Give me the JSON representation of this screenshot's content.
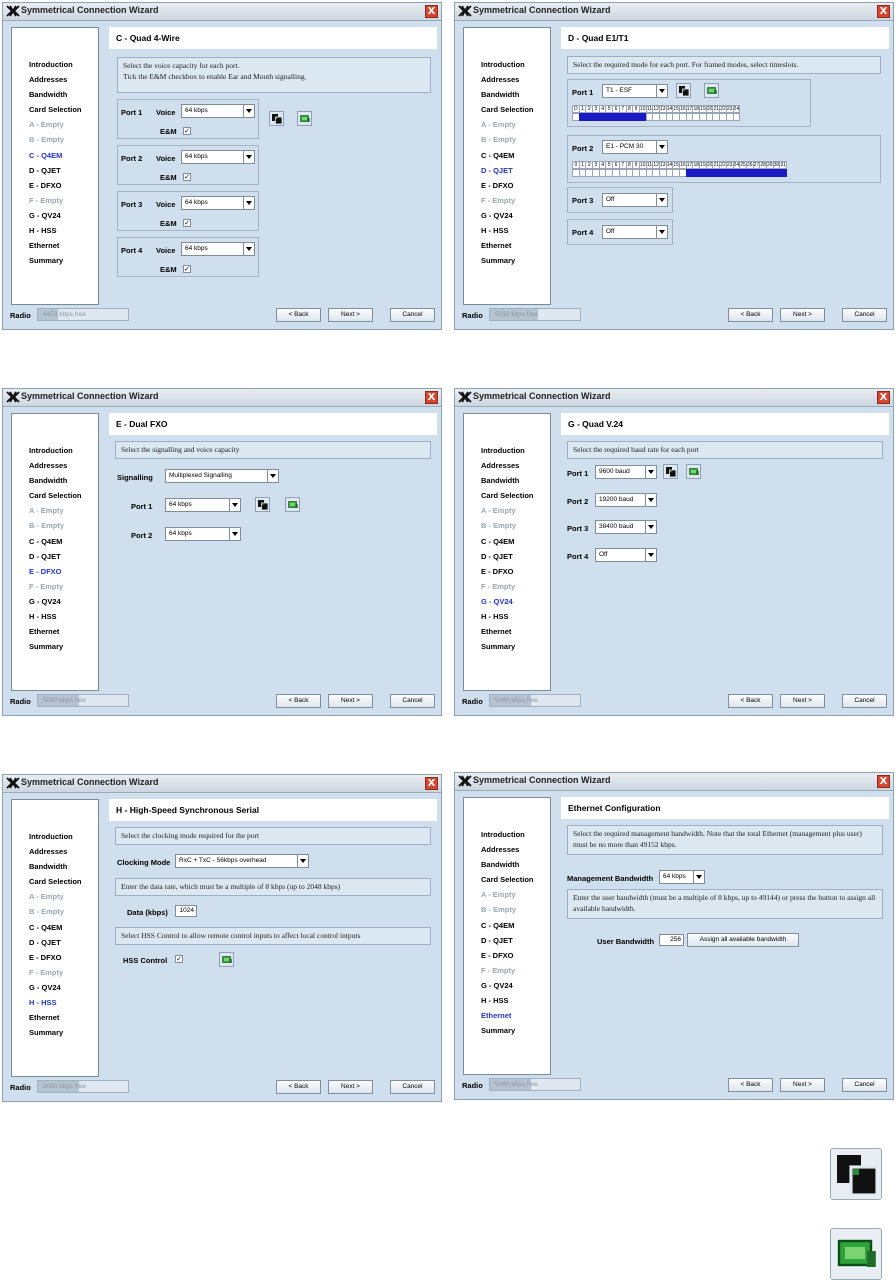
{
  "common": {
    "window_title": "Symmetrical Connection Wizard",
    "close_glyph": "X",
    "radio_label": "Radio",
    "back_label": "< Back",
    "next_label": "Next >",
    "cancel_label": "Cancel",
    "nav": [
      "Introduction",
      "Addresses",
      "Bandwidth",
      "Card Selection",
      "A - Empty",
      "B - Empty",
      "C - Q4EM",
      "D - QJET",
      "E - DFXO",
      "F - Empty",
      "G - QV24",
      "H - HSS",
      "Ethernet",
      "Summary"
    ],
    "icons": {
      "copy": "copy-ports-icon",
      "assign": "assign-card-icon"
    }
  },
  "win_c": {
    "heading": "C - Quad 4-Wire",
    "instruction": "Select the voice capacity for each port.\nTick the E&M checkbox to enable Ear and Mouth signalling.",
    "bandwidth": "4472 kbps free",
    "voice_label": "Voice",
    "em_label": "E&M",
    "ports": [
      {
        "label": "Port 1",
        "value": "64 kbps"
      },
      {
        "label": "Port 2",
        "value": "64 kbps"
      },
      {
        "label": "Port 3",
        "value": "64 kbps"
      },
      {
        "label": "Port 4",
        "value": "64 kbps"
      }
    ]
  },
  "win_d": {
    "heading": "D - Quad E1/T1",
    "instruction": "Select the required mode for each port. For framed modes, select timeslots.",
    "bandwidth": "5032 kbps free",
    "port1_label": "Port 1",
    "port1_value": "T1 - ESF",
    "port2_label": "Port 2",
    "port2_value": "E1 - PCM 30",
    "port3_label": "Port 3",
    "port3_value": "Off",
    "port4_label": "Port 4",
    "port4_value": "Off",
    "t1_slots": [
      "D",
      "1",
      "2",
      "3",
      "4",
      "5",
      "6",
      "7",
      "8",
      "9",
      "10",
      "11",
      "12",
      "13",
      "14",
      "15",
      "16",
      "17",
      "18",
      "19",
      "20",
      "21",
      "22",
      "23",
      "24"
    ],
    "e1_slots": [
      "0",
      "1",
      "2",
      "3",
      "4",
      "5",
      "6",
      "7",
      "8",
      "9",
      "10",
      "11",
      "12",
      "13",
      "14",
      "15",
      "16",
      "17",
      "18",
      "19",
      "20",
      "21",
      "22",
      "23",
      "24",
      "25",
      "26",
      "27",
      "28",
      "29",
      "30",
      "31"
    ],
    "t1_selected": [
      1,
      2,
      3,
      4,
      5,
      6,
      7,
      8,
      9,
      10
    ],
    "e1_selected": [
      17,
      18,
      19,
      20,
      21,
      22,
      23,
      24,
      25,
      26,
      27,
      28,
      29,
      30,
      31
    ]
  },
  "win_e": {
    "heading": "E - Dual FXO",
    "instruction": "Select the signalling and voice capacity",
    "bandwidth": "5080 kbps free",
    "signalling_label": "Signalling",
    "signalling_value": "Multiplexed Signalling",
    "port1_label": "Port 1",
    "port1_value": "64 kbps",
    "port2_label": "Port 2",
    "port2_value": "64 kbps"
  },
  "win_g": {
    "heading": "G - Quad V.24",
    "instruction": "Select the required baud rate for each port",
    "bandwidth": "5080 kbps free",
    "ports": [
      {
        "label": "Port 1",
        "value": "9600 baud"
      },
      {
        "label": "Port 2",
        "value": "19200 baud"
      },
      {
        "label": "Port 3",
        "value": "38400 baud"
      },
      {
        "label": "Port 4",
        "value": "Off"
      }
    ]
  },
  "win_h": {
    "heading": "H - High-Speed Synchronous Serial",
    "instruction1": "Select the clocking mode required for the port",
    "clocking_label": "Clocking Mode",
    "clocking_value": "RxC + TxC - 56kbps overhead",
    "instruction2": "Enter the data rate, which must be a multiple of 8 kbps (up to 2048 kbps)",
    "data_label": "Data (kbps)",
    "data_value": "1024",
    "instruction3": "Select HSS Control to allow remote control inputs to affect local control intputs",
    "hss_label": "HSS Control",
    "bandwidth": "5080 kbps free"
  },
  "win_eth": {
    "heading": "Ethernet Configuration",
    "instruction1": "Select the required management bandwidth. Note that the total Ethernet (management plus user) must be no more than 49152 kbps.",
    "mgmt_label": "Management Bandwidth",
    "mgmt_value": "64 kbps",
    "instruction2": "Enter the user bandwidth (must be a multiple of 8 kbps, up to 49144) or press the button to assign all available bandwidth.",
    "user_label": "User Bandwidth",
    "user_value": "256",
    "assign_label": "Assign all available bandwidth",
    "bandwidth": "5080 kbps free"
  },
  "bandwidth_fill": {
    "c": 0.22,
    "d": 0.53,
    "e": 0.45,
    "g": 0.45,
    "h": 0.45,
    "eth": 0.45
  }
}
